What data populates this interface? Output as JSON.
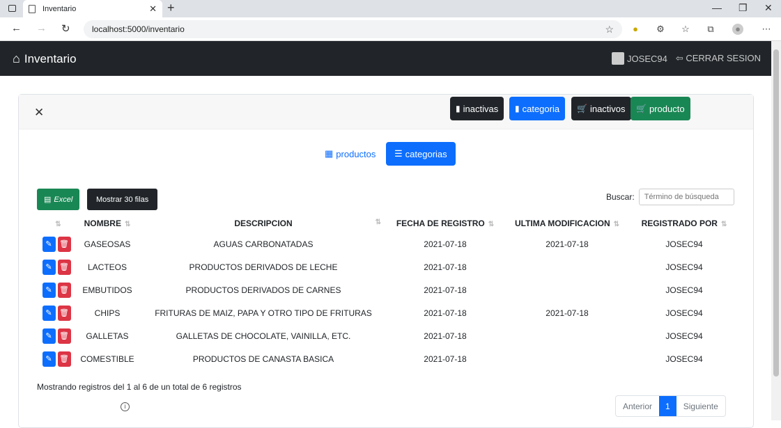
{
  "browser": {
    "tab_title": "Inventario",
    "url": "localhost:5000/inventario"
  },
  "navbar": {
    "brand": "Inventario",
    "user": "JOSEC94",
    "logout": "CERRAR SESION"
  },
  "card": {
    "header_buttons": [
      {
        "label": "inactivas",
        "color": "#212529",
        "icon": "bookmark-icon"
      },
      {
        "label": "categoria",
        "color": "#0d6efd",
        "icon": "bookmark-icon"
      },
      {
        "label": "inactivos",
        "color": "#212529",
        "icon": "cart-icon"
      },
      {
        "label": "producto",
        "color": "#198754",
        "icon": "cart-icon"
      }
    ],
    "subtabs": {
      "productos": "productos",
      "categorias": "categorias"
    },
    "toolbar": {
      "excel": "Excel",
      "show_rows": "Mostrar 30 filas",
      "search_label": "Buscar:",
      "search_placeholder": "Término de búsqueda"
    },
    "table": {
      "headers": [
        "NOMBRE",
        "DESCRIPCION",
        "FECHA DE REGISTRO",
        "ULTIMA MODIFICACION",
        "REGISTRADO POR"
      ],
      "rows": [
        [
          "GASEOSAS",
          "AGUAS CARBONATADAS",
          "2021-07-18",
          "2021-07-18",
          "JOSEC94"
        ],
        [
          "LACTEOS",
          "PRODUCTOS DERIVADOS DE LECHE",
          "2021-07-18",
          "",
          "JOSEC94"
        ],
        [
          "EMBUTIDOS",
          "PRODUCTOS DERIVADOS DE CARNES",
          "2021-07-18",
          "",
          "JOSEC94"
        ],
        [
          "CHIPS",
          "FRITURAS DE MAIZ, PAPA Y OTRO TIPO DE FRITURAS",
          "2021-07-18",
          "2021-07-18",
          "JOSEC94"
        ],
        [
          "GALLETAS",
          "GALLETAS DE CHOCOLATE, VAINILLA, ETC.",
          "2021-07-18",
          "",
          "JOSEC94"
        ],
        [
          "COMESTIBLE",
          "PRODUCTOS DE CANASTA BASICA",
          "2021-07-18",
          "",
          "JOSEC94"
        ]
      ]
    },
    "footer": {
      "info": "Mostrando registros del 1 al 6 de un total de 6 registros",
      "prev": "Anterior",
      "page": "1",
      "next": "Siguiente"
    }
  }
}
